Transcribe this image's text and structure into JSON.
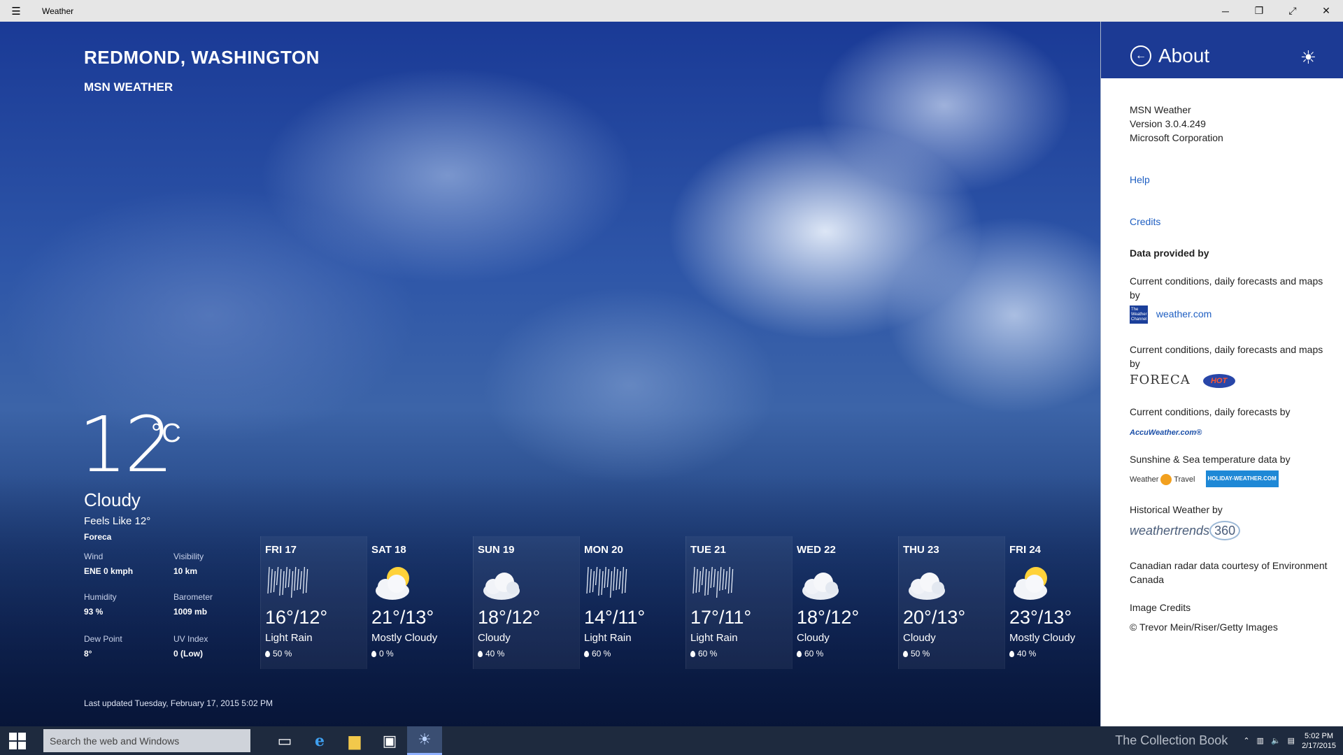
{
  "titlebar": {
    "title": "Weather",
    "menu_icon": "hamburger-icon",
    "controls": [
      "minimize-icon",
      "restore-icon",
      "fullscreen-icon",
      "close-icon"
    ]
  },
  "main": {
    "location": "REDMOND, WASHINGTON",
    "provider": "MSN WEATHER",
    "temperature": "12",
    "unit": "°C",
    "condition": "Cloudy",
    "feels_like": "Feels Like 12°",
    "source": "Foreca",
    "details": {
      "wind_label": "Wind",
      "wind_value": "ENE 0 kmph",
      "visibility_label": "Visibility",
      "visibility_value": "10 km",
      "humidity_label": "Humidity",
      "humidity_value": "93 %",
      "barometer_label": "Barometer",
      "barometer_value": "1009 mb",
      "dewpoint_label": "Dew Point",
      "dewpoint_value": "8°",
      "uv_label": "UV Index",
      "uv_value": "0 (Low)"
    },
    "last_updated": "Last updated Tuesday, February 17, 2015 5:02 PM"
  },
  "forecast": [
    {
      "day": "FRI 17",
      "hilo": "16°/12°",
      "condition": "Light Rain",
      "precip": "50 %",
      "icon": "rain-icon"
    },
    {
      "day": "SAT 18",
      "hilo": "21°/13°",
      "condition": "Mostly Cloudy",
      "precip": "0 %",
      "icon": "partly-sunny-icon"
    },
    {
      "day": "SUN 19",
      "hilo": "18°/12°",
      "condition": "Cloudy",
      "precip": "40 %",
      "icon": "cloud-icon"
    },
    {
      "day": "MON 20",
      "hilo": "14°/11°",
      "condition": "Light Rain",
      "precip": "60 %",
      "icon": "rain-icon"
    },
    {
      "day": "TUE 21",
      "hilo": "17°/11°",
      "condition": "Light Rain",
      "precip": "60 %",
      "icon": "rain-icon"
    },
    {
      "day": "WED 22",
      "hilo": "18°/12°",
      "condition": "Cloudy",
      "precip": "60 %",
      "icon": "cloud-icon"
    },
    {
      "day": "THU 23",
      "hilo": "20°/13°",
      "condition": "Cloudy",
      "precip": "50 %",
      "icon": "cloud-icon"
    },
    {
      "day": "FRI 24",
      "hilo": "23°/13°",
      "condition": "Mostly Cloudy",
      "precip": "40 %",
      "icon": "partly-sunny-icon"
    }
  ],
  "about": {
    "title": "About",
    "app_name": "MSN Weather",
    "version": "Version 3.0.4.249",
    "company": "Microsoft Corporation",
    "help": "Help",
    "credits": "Credits",
    "data_heading": "Data provided by",
    "twc_text": "Current conditions, daily forecasts and maps by",
    "twc_logo": "The Weather Channel",
    "twc_link": "weather.com",
    "foreca_text": "Current conditions, daily forecasts and maps by",
    "foreca_logo": "FORECA",
    "hot_logo": "HOT",
    "accu_text": "Current conditions, daily forecasts by",
    "accu_logo": "AccuWeather.com®",
    "sunshine_text": "Sunshine & Sea temperature data by",
    "w2t_logo_a": "Weather",
    "w2t_logo_b": "Travel",
    "hw_logo": "HOLIDAY-WEATHER.COM",
    "historical_text": "Historical Weather by",
    "wt_logo_a": "weathertrends",
    "wt_logo_b": "360",
    "radar_text": "Canadian radar data courtesy of Environment Canada",
    "image_credits_heading": "Image Credits",
    "image_credits": "© Trevor Mein/Riser/Getty Images"
  },
  "taskbar": {
    "search_placeholder": "Search the web and Windows",
    "watermark": "The Collection Book",
    "time": "5:02 PM",
    "date": "2/17/2015"
  }
}
